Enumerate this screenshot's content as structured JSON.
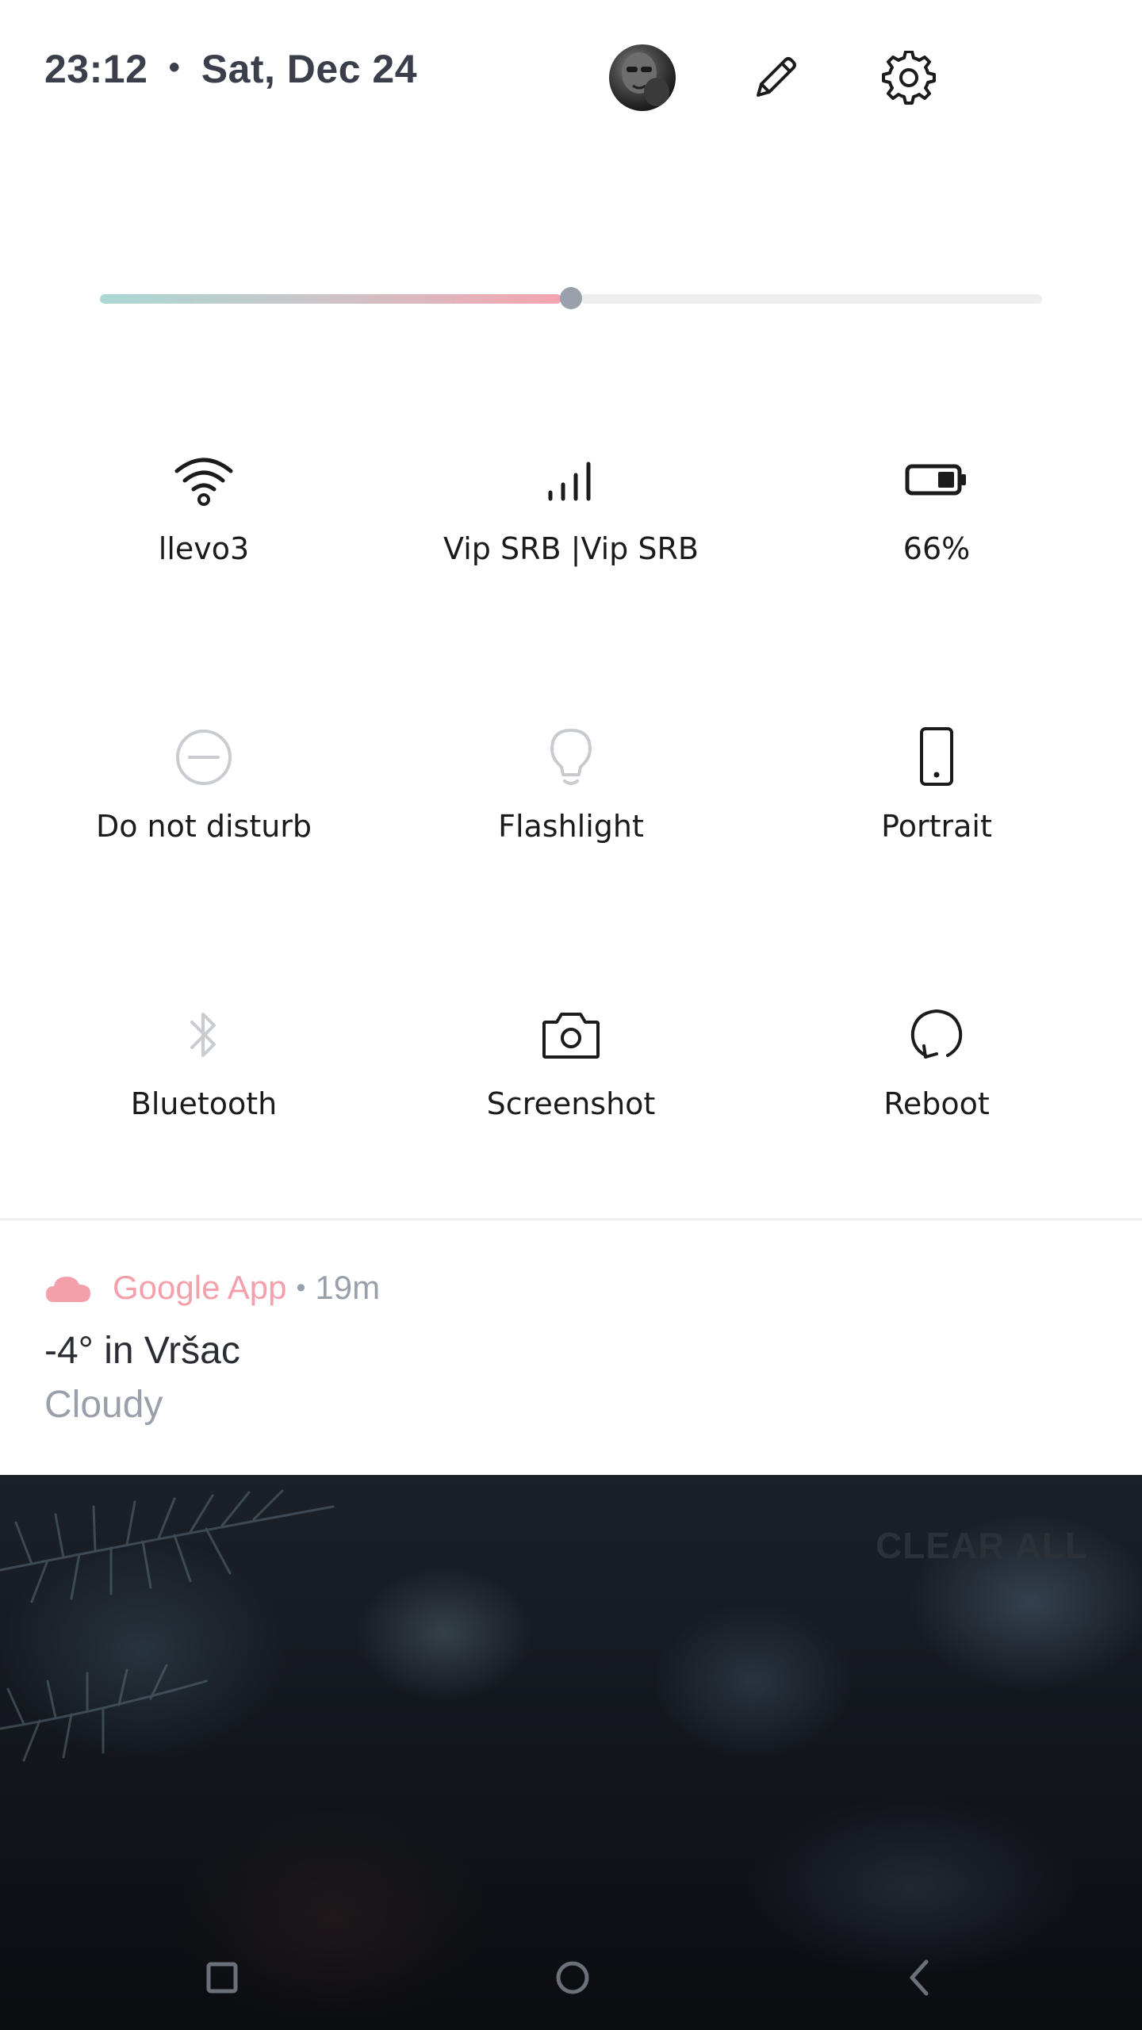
{
  "header": {
    "time": "23:12",
    "date": "Sat, Dec 24",
    "separator": "•",
    "icons": [
      "avatar",
      "edit-icon",
      "settings-gear-icon"
    ]
  },
  "brightness": {
    "level": 0.5
  },
  "tiles": [
    {
      "label": "llevo3",
      "icon": "wifi-icon",
      "active": true
    },
    {
      "label": "Vip SRB |Vip SRB",
      "icon": "cellular-signal-icon",
      "active": true
    },
    {
      "label": "66%",
      "icon": "battery-icon",
      "active": true
    },
    {
      "label": "Do not disturb",
      "icon": "do-not-disturb-icon",
      "active": false
    },
    {
      "label": "Flashlight",
      "icon": "flashlight-bulb-icon",
      "active": false
    },
    {
      "label": "Portrait",
      "icon": "portrait-phone-icon",
      "active": true
    },
    {
      "label": "Bluetooth",
      "icon": "bluetooth-icon",
      "active": false
    },
    {
      "label": "Screenshot",
      "icon": "camera-icon",
      "active": true
    },
    {
      "label": "Reboot",
      "icon": "reboot-icon",
      "active": true
    }
  ],
  "notification": {
    "icon": "cloud-icon",
    "app": "Google App",
    "separator": "•",
    "age": "19m",
    "title": "-4° in Vršac",
    "text": "Cloudy",
    "accent_color": "#f4a0ab"
  },
  "clear_all_label": "CLEAR ALL",
  "navbar": {
    "icons": [
      "recents-square-icon",
      "home-circle-icon",
      "back-chevron-icon"
    ]
  },
  "colors": {
    "panel_bg": "#ffffff",
    "active_icon": "#1b1b1b",
    "inactive_icon": "#c8cbd0",
    "header_text": "#3a3f4b"
  }
}
